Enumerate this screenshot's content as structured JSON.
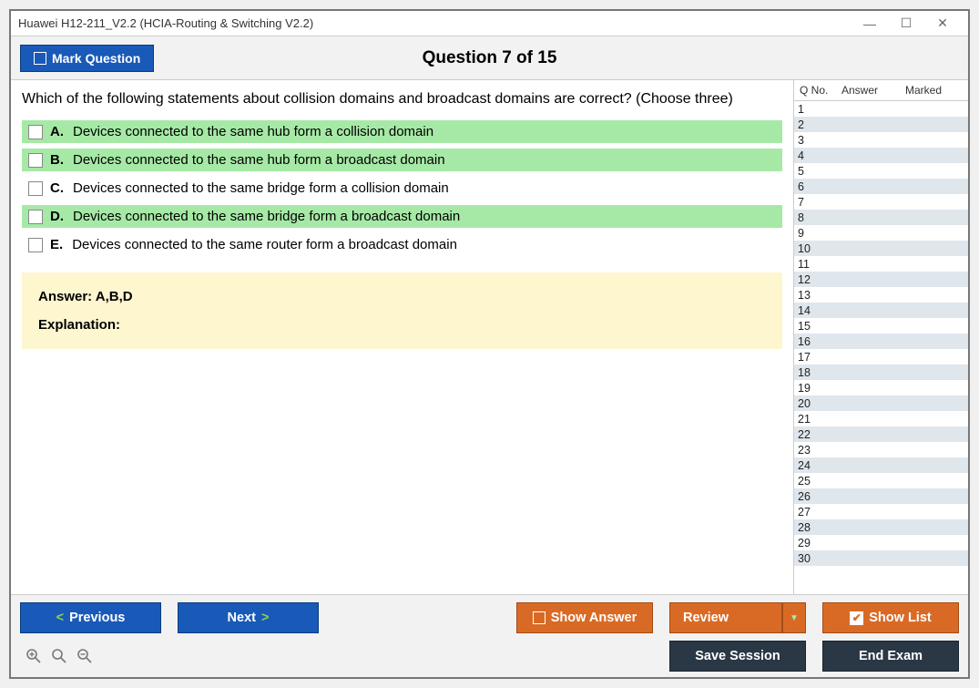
{
  "window": {
    "title": "Huawei H12-211_V2.2 (HCIA-Routing & Switching V2.2)"
  },
  "header": {
    "mark_label": "Mark Question",
    "question_counter": "Question 7 of 15"
  },
  "question": {
    "text": "Which of the following statements about collision domains and broadcast domains are correct? (Choose three)",
    "options": [
      {
        "letter": "A.",
        "text": "Devices connected to the same hub form a collision domain",
        "correct": true
      },
      {
        "letter": "B.",
        "text": "Devices connected to the same hub form a broadcast domain",
        "correct": true
      },
      {
        "letter": "C.",
        "text": "Devices connected to the same bridge form a collision domain",
        "correct": false
      },
      {
        "letter": "D.",
        "text": "Devices connected to the same bridge form a broadcast domain",
        "correct": true
      },
      {
        "letter": "E.",
        "text": "Devices connected to the same router form a broadcast domain",
        "correct": false
      }
    ],
    "answer_label": "Answer: A,B,D",
    "explanation_label": "Explanation:"
  },
  "side": {
    "col_qno": "Q No.",
    "col_answer": "Answer",
    "col_marked": "Marked",
    "rows": [
      1,
      2,
      3,
      4,
      5,
      6,
      7,
      8,
      9,
      10,
      11,
      12,
      13,
      14,
      15,
      16,
      17,
      18,
      19,
      20,
      21,
      22,
      23,
      24,
      25,
      26,
      27,
      28,
      29,
      30
    ]
  },
  "footer": {
    "previous": "Previous",
    "next": "Next",
    "show_answer": "Show Answer",
    "review": "Review",
    "show_list": "Show List",
    "save_session": "Save Session",
    "end_exam": "End Exam"
  }
}
